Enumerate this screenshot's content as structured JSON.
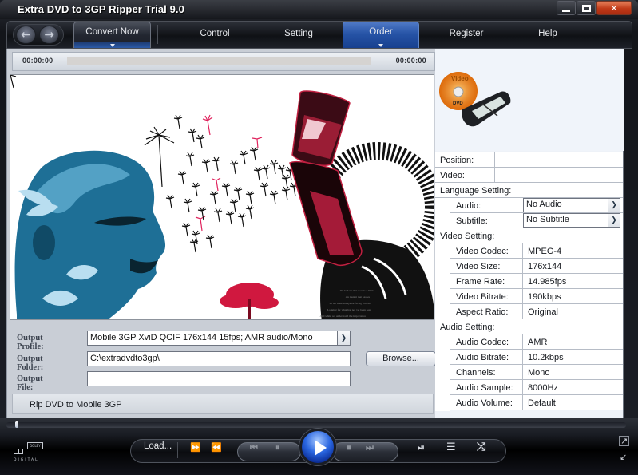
{
  "window": {
    "title": "Extra DVD to 3GP Ripper Trial 9.0",
    "controls": {
      "minimize": "minimize-icon",
      "maximize": "maximize-icon",
      "close": "✕"
    }
  },
  "nav": {
    "back_icon": "←",
    "forward_icon": "→",
    "tabs": [
      {
        "label": "Convert Now",
        "style": "boxed",
        "has_dropdown": true
      },
      {
        "label": "Control"
      },
      {
        "label": "Setting"
      },
      {
        "label": "Order",
        "style": "active",
        "has_dropdown": true
      },
      {
        "label": "Register"
      },
      {
        "label": "Help"
      }
    ]
  },
  "player": {
    "time_start": "00:00:00",
    "time_end": "00:00:00",
    "seek_progress": 0
  },
  "preview": {
    "caption_lines": [
      "We believe that now is a blink",
      "An instant that passes",
      "So we must always be facing forward",
      "Looking for what has not yet been seen",
      "And while we understand the importance"
    ],
    "colors": {
      "face": "#2a7fa8",
      "accent": "#d0183f",
      "ink": "#111111"
    }
  },
  "form": {
    "output_profile": {
      "label": "Output Profile:",
      "value": "Mobile 3GP  XviD QCIF 176x144 15fps;  AMR audio/Mono"
    },
    "output_folder": {
      "label": "Output Folder:",
      "value": "C:\\extradvdto3gp\\"
    },
    "output_file": {
      "label": "Output File:",
      "value": ""
    },
    "browse_label": "Browse...",
    "status": "Rip DVD to Mobile 3GP"
  },
  "properties": {
    "position_label": "Position:",
    "position_value": "",
    "video_label": "Video:",
    "video_value": "",
    "language": {
      "title": "Language Setting:",
      "audio": {
        "label": "Audio:",
        "value": "No Audio"
      },
      "subtitle": {
        "label": "Subtitle:",
        "value": "No Subtitle"
      }
    },
    "video": {
      "title": "Video Setting:",
      "rows": [
        {
          "label": "Video Codec:",
          "value": "MPEG-4"
        },
        {
          "label": "Video Size:",
          "value": "176x144"
        },
        {
          "label": "Frame Rate:",
          "value": "14.985fps"
        },
        {
          "label": "Video Bitrate:",
          "value": "190kbps"
        },
        {
          "label": "Aspect Ratio:",
          "value": "Original"
        }
      ]
    },
    "audio": {
      "title": "Audio Setting:",
      "rows": [
        {
          "label": "Audio Codec:",
          "value": "AMR"
        },
        {
          "label": "Audio Bitrate:",
          "value": "10.2kbps"
        },
        {
          "label": "Channels:",
          "value": "Mono"
        },
        {
          "label": "Audio Sample:",
          "value": "8000Hz"
        },
        {
          "label": "Audio Volume:",
          "value": "Default"
        }
      ]
    }
  },
  "logo": {
    "disc_text": "Video",
    "disc_sub": "DVD"
  },
  "transport": {
    "load_label": "Load...",
    "buttons": {
      "fast_forward": "⏩",
      "rewind": "⏪",
      "previous": "⏮",
      "pause": "⏸",
      "play": "play-icon",
      "stop": "⏹",
      "next": "⏭",
      "step": "⏯",
      "playlist": "☰",
      "shuffle": "⤮"
    },
    "dolby_text": "DOLBY",
    "dolby_sub": "DIGITAL",
    "compact_icon": "↗",
    "restore_icon": "↙"
  }
}
